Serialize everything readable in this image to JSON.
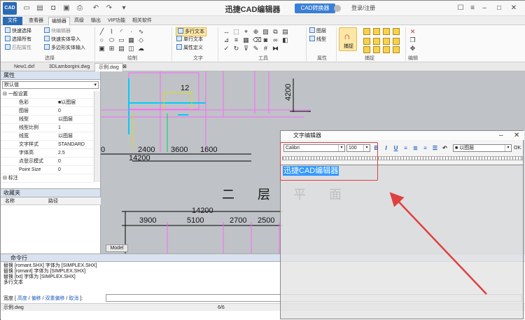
{
  "app": {
    "logo": "CAD",
    "title": "迅捷CAD编辑器",
    "convert_button": "CAD转换器",
    "login": "登录/注册"
  },
  "ribbon_tabs": [
    "文件",
    "查看器",
    "编辑器",
    "高级",
    "输出",
    "VIP功能",
    "相关软件"
  ],
  "ribbon": {
    "select_group": {
      "label": "选择",
      "items": [
        "快速选择",
        "选择所有",
        "匹配属性",
        "块编辑器",
        "快速实体导入",
        "多边形实体输入"
      ]
    },
    "draw_group": {
      "label": "绘制"
    },
    "text_group": {
      "label": "文字",
      "items": [
        "多行文本",
        "单行文本",
        "属性定义"
      ]
    },
    "tools_group": {
      "label": "工具"
    },
    "props_group": {
      "label": "属性",
      "items": [
        "图层",
        "线型"
      ]
    },
    "snap_group": {
      "label": "捕捉",
      "big_button": "捕捉"
    },
    "edit_group": {
      "label": "编辑"
    }
  },
  "doc_tabs": [
    "New1.dxf",
    "3DLamborgini.dwg",
    "示例.dwg"
  ],
  "properties": {
    "title": "属性",
    "default_value": "默认值",
    "sections": [
      "一般设置",
      "标注"
    ],
    "rows": [
      {
        "k": "色彩",
        "v": "■以图层"
      },
      {
        "k": "图层",
        "v": "0"
      },
      {
        "k": "线型",
        "v": "以图层"
      },
      {
        "k": "线型比例",
        "v": "1"
      },
      {
        "k": "线宽",
        "v": "以图层"
      },
      {
        "k": "文字样式",
        "v": "STANDARD"
      },
      {
        "k": "字体高",
        "v": "2.5"
      },
      {
        "k": "点登示模式",
        "v": "0"
      },
      {
        "k": "Point Size",
        "v": "0"
      }
    ]
  },
  "favorites": {
    "title": "收藏夹",
    "columns": [
      "名称",
      "路径"
    ]
  },
  "canvas": {
    "dims_top": [
      "2400",
      "3600",
      "1600"
    ],
    "dim_total_top": "14200",
    "dim_vertical": "4200",
    "dim_left_partial": "0",
    "room_number": "12",
    "plan_title": "二 层 平 面",
    "dim_total_mid": "14200",
    "dims_mid": [
      "3900",
      "5100",
      "2700",
      "2500"
    ],
    "model_tab": "Model"
  },
  "command": {
    "title": "命令行",
    "lines": [
      "替换 [romant.SHX] 字体为 [SIMPLEX.SHX]",
      "替换 [romant] 字体为 [SIMPLEX.SHX]",
      "替换 [txt] 字体为 [SIMPLEX.SHX]",
      "多行文本"
    ],
    "options_prefix": "宽度",
    "options": [
      "高度",
      "偏移",
      "双重偏移",
      "取消"
    ],
    "status_file": "示例.dwg",
    "status_page": "6/6"
  },
  "text_editor": {
    "title": "文字编辑器",
    "font": "Calibri",
    "size": "100",
    "layer": "以图层",
    "ok": "OK",
    "format_buttons": [
      "B",
      "I",
      "U"
    ],
    "content": "迅捷CAD编辑器"
  },
  "colors": {
    "accent": "#2a6ab4",
    "highlight": "#e04040",
    "selection": "#3399ff"
  }
}
